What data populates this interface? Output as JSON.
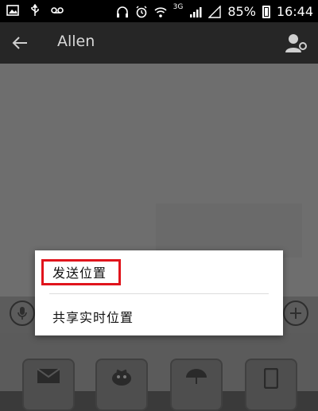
{
  "status_bar": {
    "network": "3G",
    "battery": "85%",
    "time": "16:44"
  },
  "nav": {
    "title": "Allen"
  },
  "menu": {
    "items": [
      "发送位置",
      "共享实时位置"
    ]
  },
  "colors": {
    "highlight": "#e0141c",
    "nav_bg": "#262626",
    "chat_bg": "#6e6e6e"
  },
  "icons": [
    "image-icon",
    "usb-icon",
    "voicemail-icon",
    "headphones-icon",
    "alarm-icon",
    "wifi-icon",
    "signal-icon",
    "battery-icon",
    "back-arrow-icon",
    "contact-profile-icon",
    "microphone-icon",
    "plus-icon",
    "envelope-icon",
    "bird-icon",
    "umbrella-icon",
    "phone-icon"
  ]
}
